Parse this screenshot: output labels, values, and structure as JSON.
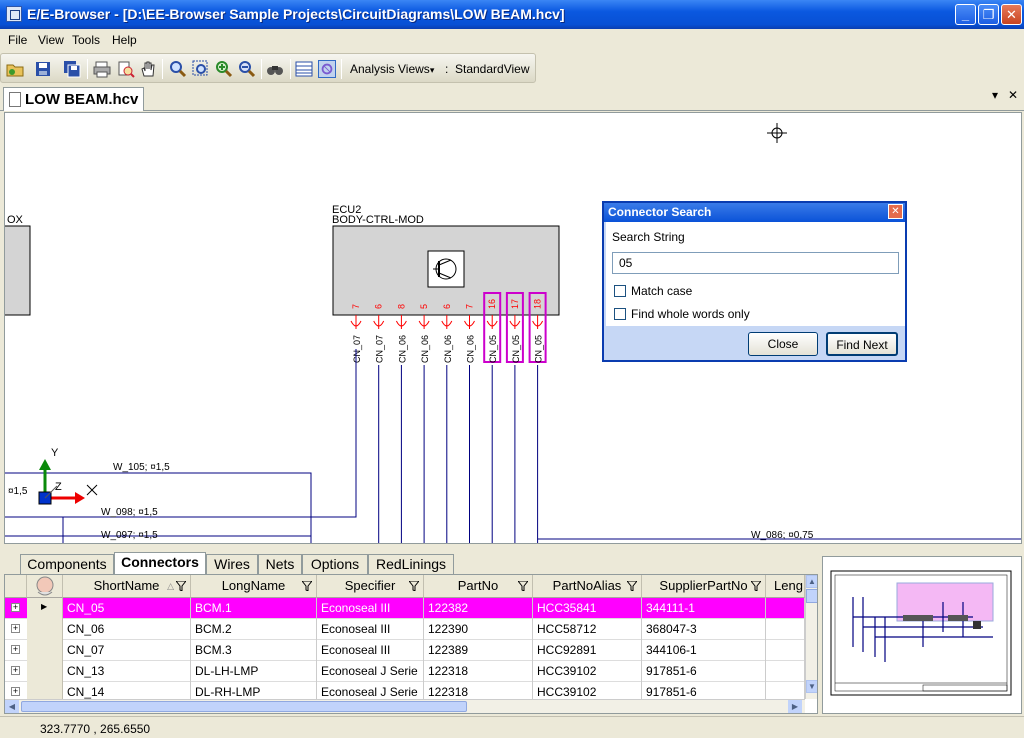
{
  "window": {
    "title": "E/E-Browser - [D:\\EE-Browser Sample Projects\\CircuitDiagrams\\LOW BEAM.hcv]",
    "minimize": "_",
    "restore": "❐",
    "close": "✕"
  },
  "menu": {
    "file": "File",
    "view": "View",
    "tools": "Tools",
    "help": "Help"
  },
  "toolbar": {
    "analysis_views": "Analysis Views",
    "view_sep": ":",
    "current_view": "StandardView"
  },
  "document": {
    "tab_label": "LOW BEAM.hcv",
    "dropdown": "▾",
    "close": "✕"
  },
  "schematic": {
    "left_box_label": "OX",
    "ecu_name": "ECU2",
    "ecu_function": "BODY-CTRL-MOD",
    "pins": [
      "7",
      "6",
      "8",
      "5",
      "6",
      "7",
      "16",
      "17",
      "18"
    ],
    "pin_connectors": [
      "CN_07",
      "CN_07",
      "CN_06",
      "CN_06",
      "CN_06",
      "CN_06",
      "CN_05",
      "CN_05",
      "CN_05"
    ],
    "wires": {
      "w105": "W_105; ¤1,5",
      "w098": "W_098; ¤1,5",
      "w097": "W_097; ¤1,5",
      "w086": "W_086; ¤0,75",
      "left_partial": "¤1,5"
    },
    "axis_y": "Y",
    "axis_x": "X",
    "axis_z": "Z",
    "colors": {
      "pin": "#ff0000",
      "highlight": "#cc00cc",
      "wire": "#000080",
      "ecu_fill": "#d4d4d4"
    }
  },
  "dialog": {
    "title": "Connector Search",
    "close": "✕",
    "search_label": "Search String",
    "search_value": "05",
    "match_case": "Match case",
    "whole_words": "Find whole words only",
    "close_button": "Close",
    "find_next_button": "Find Next"
  },
  "bottom_tabs": [
    "Components",
    "Connectors",
    "Wires",
    "Nets",
    "Options",
    "RedLinings"
  ],
  "grid": {
    "columns": [
      "ShortName",
      "LongName",
      "Specifier",
      "PartNo",
      "PartNoAlias",
      "SupplierPartNo",
      "Leng"
    ],
    "rows": [
      {
        "ShortName": "CN_05",
        "LongName": "BCM.1",
        "Specifier": "Econoseal III",
        "PartNo": "122382",
        "PartNoAlias": "HCC35841",
        "SupplierPartNo": "344111-1",
        "selected": true
      },
      {
        "ShortName": "CN_06",
        "LongName": "BCM.2",
        "Specifier": "Econoseal III",
        "PartNo": "122390",
        "PartNoAlias": "HCC58712",
        "SupplierPartNo": "368047-3",
        "selected": false
      },
      {
        "ShortName": "CN_07",
        "LongName": "BCM.3",
        "Specifier": "Econoseal III",
        "PartNo": "122389",
        "PartNoAlias": "HCC92891",
        "SupplierPartNo": "344106-1",
        "selected": false
      },
      {
        "ShortName": "CN_13",
        "LongName": "DL-LH-LMP",
        "Specifier": "Econoseal J Serie",
        "PartNo": "122318",
        "PartNoAlias": "HCC39102",
        "SupplierPartNo": "917851-6",
        "selected": false
      },
      {
        "ShortName": "CN_14",
        "LongName": "DL-RH-LMP",
        "Specifier": "Econoseal J Serie",
        "PartNo": "122318",
        "PartNoAlias": "HCC39102",
        "SupplierPartNo": "917851-6",
        "selected": false
      }
    ]
  },
  "status": {
    "coordinates": "323.7770 , 265.6550"
  }
}
